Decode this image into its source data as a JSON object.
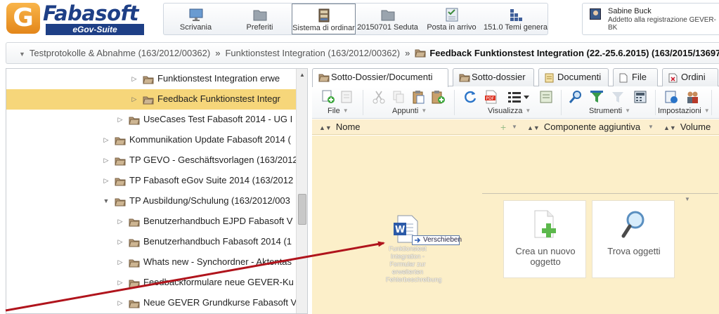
{
  "logo": {
    "letter": "G",
    "name": "Fabasoft",
    "subtitle": "eGov-Suite"
  },
  "toolbar": {
    "items": [
      {
        "label": "Scrivania",
        "icon": "monitor-icon"
      },
      {
        "label": "Preferiti",
        "icon": "folder-icon"
      },
      {
        "label": "Sistema di ordinar",
        "icon": "cabinet-icon",
        "active": true
      },
      {
        "label": "20150701 Seduta",
        "icon": "folder-icon"
      },
      {
        "label": "Posta in arrivo",
        "icon": "inbox-icon"
      },
      {
        "label": "151.0 Temi genera",
        "icon": "blocks-icon"
      }
    ]
  },
  "user": {
    "name": "Sabine Buck",
    "role": "Addetto alla registrazione GEVER-BK"
  },
  "breadcrumb": {
    "items": [
      "Testprotokolle & Abnahme (163/2012/00362)",
      "Funktionstest Integration (163/2012/00362)"
    ],
    "separator": "»",
    "current": "Feedback Funktionstest Integration (22.-25.6.2015) (163/2015/13697"
  },
  "tree": {
    "rows": [
      {
        "label": "Funktionstest Integration erwe",
        "level": 3,
        "toggle": "collapsed"
      },
      {
        "label": "Feedback Funktionstest Integr",
        "level": 3,
        "toggle": "collapsed",
        "selected": true
      },
      {
        "label": "UseCases Test Fabasoft 2014 - UG I",
        "level": 2,
        "toggle": "collapsed"
      },
      {
        "label": "Kommunikation Update Fabasoft 2014 (",
        "level": 1,
        "toggle": "collapsed"
      },
      {
        "label": "TP GEVO - Geschäftsvorlagen (163/2012/",
        "level": 1,
        "toggle": "collapsed"
      },
      {
        "label": "TP Fabasoft eGov Suite 2014 (163/2012",
        "level": 1,
        "toggle": "collapsed"
      },
      {
        "label": "TP Ausbildung/Schulung (163/2012/003",
        "level": 1,
        "toggle": "expanded"
      },
      {
        "label": "Benutzerhandbuch EJPD Fabasoft V",
        "level": 2,
        "toggle": "collapsed"
      },
      {
        "label": "Benutzerhandbuch Fabasoft 2014 (1",
        "level": 2,
        "toggle": "collapsed"
      },
      {
        "label": "Whats new - Synchordner - Aktentas",
        "level": 2,
        "toggle": "collapsed"
      },
      {
        "label": "Feedbackformulare neue GEVER-Ku",
        "level": 2,
        "toggle": "collapsed"
      },
      {
        "label": "Neue GEVER Grundkurse Fabasoft V",
        "level": 2,
        "toggle": "collapsed"
      }
    ]
  },
  "tabs": [
    {
      "label": "Sotto-Dossier/Documenti",
      "icon": "folder-icon",
      "active": true
    },
    {
      "label": "Sotto-dossier",
      "icon": "folder-icon"
    },
    {
      "label": "Documenti",
      "icon": "document-icon"
    },
    {
      "label": "File",
      "icon": "file-icon"
    },
    {
      "label": "Ordini",
      "icon": "order-icon"
    }
  ],
  "ribbon": {
    "groups": [
      {
        "label": "File"
      },
      {
        "label": "Appunti"
      },
      {
        "label": "Visualizza"
      },
      {
        "label": "Strumenti"
      },
      {
        "label": "Impostazioni"
      }
    ]
  },
  "columns": {
    "name": "Nome",
    "component": "Componente aggiuntiva",
    "volume": "Volume"
  },
  "content": {
    "actions": [
      {
        "label": "Crea un nuovo oggetto",
        "icon": "new-object-icon"
      },
      {
        "label": "Trova oggetti",
        "icon": "magnifier-icon"
      }
    ],
    "drag": {
      "tooltip": "Verschieben",
      "file_label": "Funktionstest Integration - Formular zur erweiterten Fehlerbeschreibung"
    }
  },
  "colors": {
    "brand_blue": "#1e3f86",
    "brand_orange": "#f0a030",
    "selected_row": "#f6d67a",
    "content_bg": "#fcefc9",
    "arrow": "#b0141c"
  }
}
